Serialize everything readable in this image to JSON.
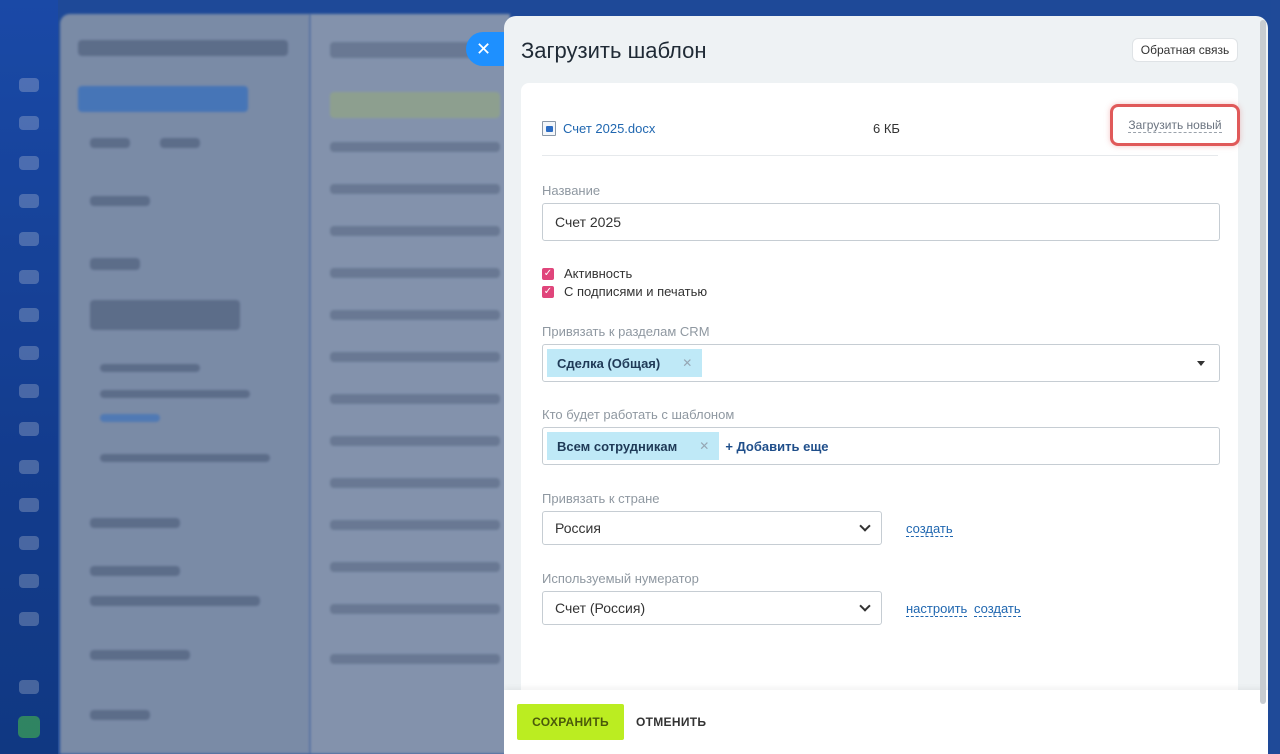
{
  "header": {
    "title": "Загрузить шаблон",
    "feedback_label": "Обратная связь",
    "close_symbol": "✕"
  },
  "file": {
    "name": "Счет 2025.docx",
    "size": "6 КБ",
    "upload_new_label": "Загрузить новый",
    "icon": "docx-file-icon"
  },
  "form": {
    "name_label": "Название",
    "name_value": "Счет 2025",
    "checkboxes": [
      {
        "label": "Активность",
        "checked": true
      },
      {
        "label": "С подписями и печатью",
        "checked": true
      }
    ],
    "crm_label": "Привязать к разделам CRM",
    "crm_tags": [
      "Сделка (Общая)"
    ],
    "users_label": "Кто будет работать с шаблоном",
    "users_tags": [
      "Всем сотрудникам"
    ],
    "add_more_label": "+ Добавить еще",
    "country_label": "Привязать к стране",
    "country_value": "Россия",
    "country_create_link": "создать",
    "numerator_label": "Используемый нумератор",
    "numerator_value": "Счет (Россия)",
    "numerator_configure_link": "настроить",
    "numerator_create_link": "создать"
  },
  "footer": {
    "save_label": "СОХРАНИТЬ",
    "cancel_label": "ОТМЕНИТЬ"
  },
  "colors": {
    "accent_blue": "#2067b0",
    "save_green": "#bbed21",
    "checkbox_pink": "#e0457b",
    "tag_blue": "#bfe9f7",
    "highlight_red": "#e05a5a"
  }
}
